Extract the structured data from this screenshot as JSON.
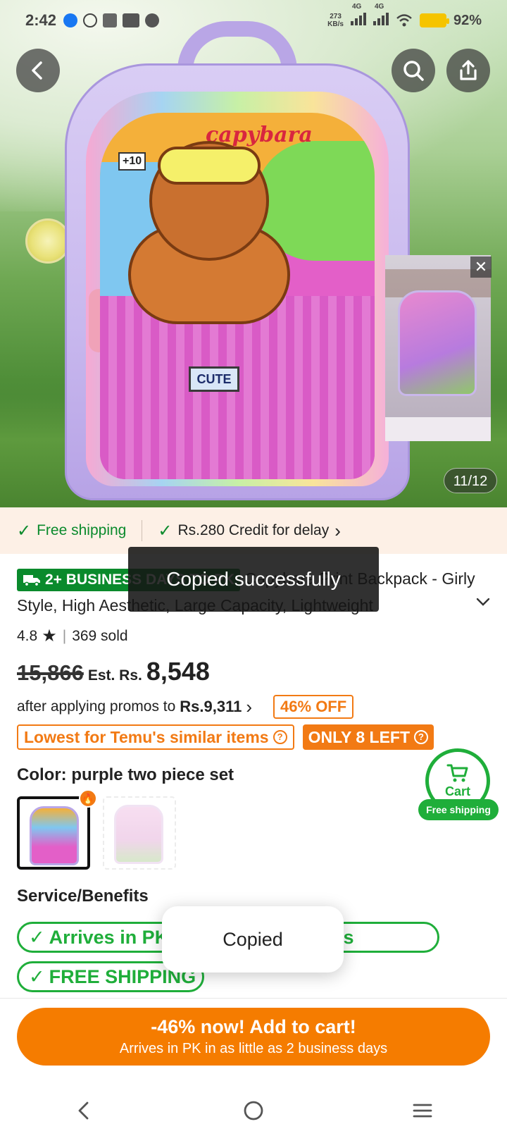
{
  "status_bar": {
    "time": "2:42",
    "net_speed_value": "273",
    "net_speed_unit": "KB/s",
    "network_1": "4G",
    "network_2": "4G",
    "battery": "92%"
  },
  "gallery": {
    "counter": "11/12",
    "image_text_title": "capybara",
    "image_text_badge": "CUTE",
    "image_text_sticker": "+10"
  },
  "video_thumb": {
    "close_glyph": "✕"
  },
  "shipping_bar": {
    "free_shipping": "Free shipping",
    "credit": "Rs.280 Credit for delay",
    "credit_chevron": "›"
  },
  "product": {
    "delivery_badge": "2+ BUSINESS DAYS TO PK",
    "title": "Capybara Print Backpack - Girly Style, High Aesthetic, Large Capacity, Lightweight",
    "rating": "4.8",
    "sold": "369 sold",
    "old_price": "15,866",
    "est_label": "Est. Rs.",
    "price": "8,548",
    "promo_text": "after applying promos to",
    "promo_price": "Rs.9,311",
    "promo_chevron": "›",
    "off_badge": "46% OFF",
    "lowest_tag": "Lowest for Temu's similar items",
    "stock_tag": "ONLY 8 LEFT",
    "color_label": "Color: purple two piece set"
  },
  "cart_float": {
    "label": "Cart",
    "free_shipping": "Free shipping"
  },
  "service": {
    "label": "Service/Benefits",
    "pill_1": "Arrives in PK in 2+ business days",
    "pill_2": "FREE SHIPPING"
  },
  "add_to_cart": {
    "line1": "-46% now! Add to cart!",
    "line2": "Arrives in PK in as little as 2 business days"
  },
  "toasts": {
    "dark": "Copied successfully",
    "light": "Copied"
  },
  "colors": {
    "brand_orange": "#f57c00",
    "green": "#1fae3a",
    "dark_green": "#0a8a2c"
  },
  "icons": [
    "back-icon",
    "search-icon",
    "share-icon",
    "close-icon",
    "check-icon",
    "truck-icon",
    "star-icon",
    "chevron-down-icon",
    "help-icon",
    "fire-icon",
    "cart-icon",
    "nav-back-icon",
    "nav-home-icon",
    "nav-menu-icon"
  ]
}
